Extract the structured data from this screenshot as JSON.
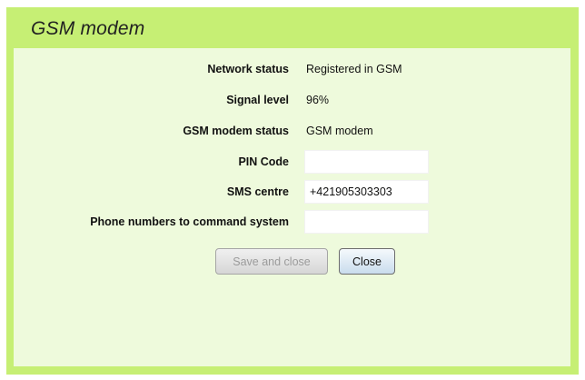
{
  "dialog": {
    "title": "GSM modem"
  },
  "fields": {
    "network_status": {
      "label": "Network status",
      "value": "Registered in GSM"
    },
    "signal_level": {
      "label": "Signal level",
      "value": "96%"
    },
    "modem_status": {
      "label": "GSM modem status",
      "value": "GSM modem"
    },
    "pin_code": {
      "label": "PIN Code",
      "value": ""
    },
    "sms_centre": {
      "label": "SMS centre",
      "value": "+421905303303"
    },
    "phone_numbers": {
      "label": "Phone numbers to command system",
      "value": ""
    }
  },
  "buttons": {
    "save_label": "Save and close",
    "save_disabled": true,
    "close_label": "Close"
  },
  "colors": {
    "frame": "#c6ef74",
    "body": "#eefadc"
  }
}
